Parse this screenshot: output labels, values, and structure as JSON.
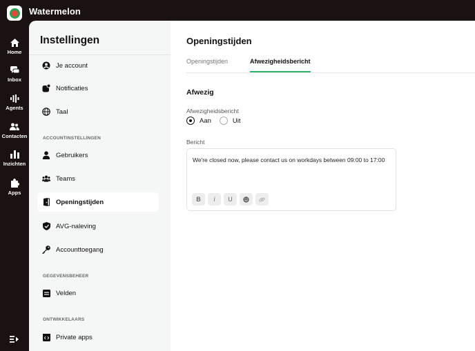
{
  "app": {
    "title": "Watermelon"
  },
  "nav": {
    "items": [
      {
        "label": "Home",
        "icon": "home-icon"
      },
      {
        "label": "Inbox",
        "icon": "inbox-icon"
      },
      {
        "label": "Agents",
        "icon": "agents-icon"
      },
      {
        "label": "Contacten",
        "icon": "contacts-icon"
      },
      {
        "label": "Inzichten",
        "icon": "insights-icon"
      },
      {
        "label": "Apps",
        "icon": "puzzle-icon"
      }
    ]
  },
  "settings": {
    "title": "Instellingen",
    "items": [
      {
        "label": "Je account",
        "icon": "user-circle-icon"
      },
      {
        "label": "Notificaties",
        "icon": "notification-icon"
      },
      {
        "label": "Taal",
        "icon": "globe-icon"
      }
    ],
    "sections": [
      {
        "title": "ACCOUNTINSTELLINGEN",
        "items": [
          {
            "label": "Gebruikers",
            "icon": "user-icon"
          },
          {
            "label": "Teams",
            "icon": "team-icon"
          },
          {
            "label": "Openingstijden",
            "icon": "door-icon",
            "active": true
          },
          {
            "label": "AVG-naleving",
            "icon": "shield-icon"
          },
          {
            "label": "Accounttoegang",
            "icon": "key-icon"
          }
        ]
      },
      {
        "title": "GEGEVENSBEHEER",
        "items": [
          {
            "label": "Velden",
            "icon": "fields-icon"
          }
        ]
      },
      {
        "title": "ONTWIKKELAARS",
        "items": [
          {
            "label": "Private apps",
            "icon": "code-icon"
          }
        ]
      }
    ]
  },
  "main": {
    "title": "Openingstijden",
    "tabs": [
      {
        "label": "Openingstijden",
        "active": false
      },
      {
        "label": "Afwezigheidsbericht",
        "active": true
      }
    ],
    "section_title": "Afwezig",
    "away_label": "Afwezigheidsbericht",
    "radio": {
      "on": "Aan",
      "off": "Uit",
      "selected": "Aan"
    },
    "message_label": "Bericht",
    "message": "We're closed now, please contact us on workdays between 09:00 to 17:00",
    "format_buttons": [
      "B",
      "i",
      "U",
      "emoji",
      "link"
    ]
  },
  "colors": {
    "accent": "#2db36b",
    "nav_bg": "#1a1210",
    "sidebar_bg": "#f5f6f6"
  }
}
